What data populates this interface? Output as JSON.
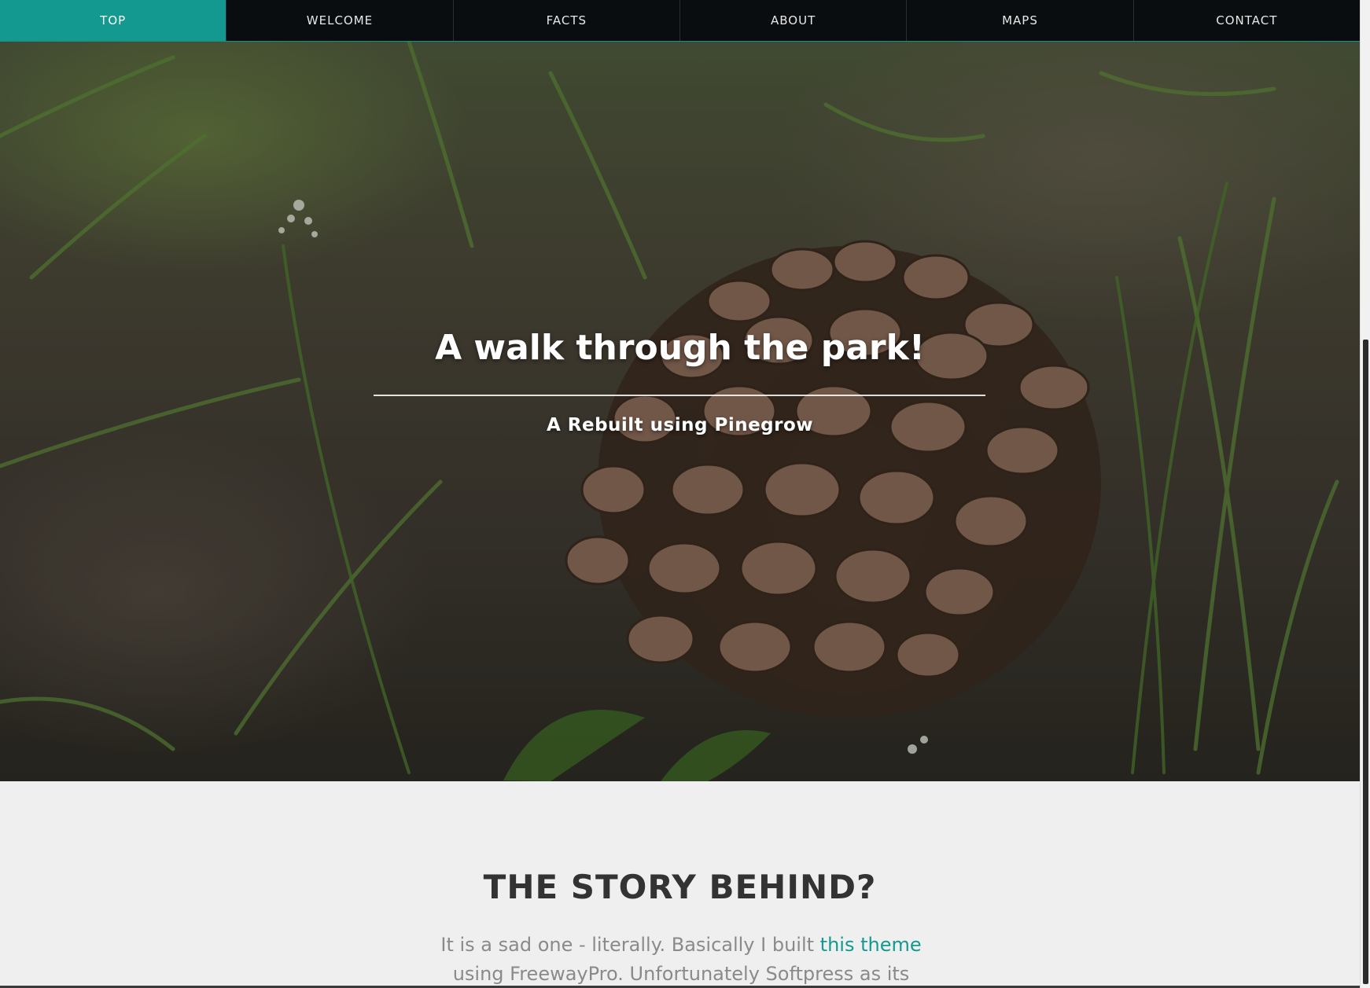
{
  "nav": {
    "items": [
      {
        "label": "TOP",
        "active": true
      },
      {
        "label": "WELCOME",
        "active": false
      },
      {
        "label": "FACTS",
        "active": false
      },
      {
        "label": "ABOUT",
        "active": false
      },
      {
        "label": "MAPS",
        "active": false
      },
      {
        "label": "CONTACT",
        "active": false
      }
    ],
    "active_color": "#13998f",
    "background_color": "#0a0d10"
  },
  "hero": {
    "title": "A walk through the park!",
    "subtitle": "A Rebuilt using Pinegrow",
    "image_subject": "pine-cone-in-grass"
  },
  "story": {
    "title": "THE STORY BEHIND?",
    "text_before_link": "It is a sad one - literally. Basically I built ",
    "link_text": "this theme",
    "text_after_link": " using FreewayPro. Unfortunately Softpress as its manufacturer",
    "link_color": "#13998f"
  }
}
